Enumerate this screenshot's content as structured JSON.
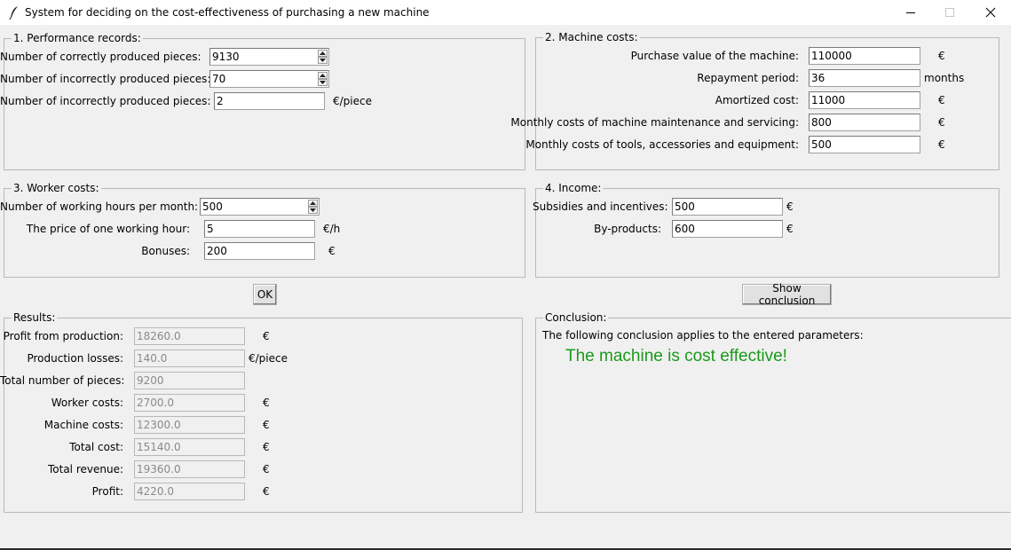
{
  "window": {
    "title": "System for deciding on the cost-effectiveness of purchasing a new machine",
    "icons": {
      "app": "feather-icon",
      "minimize": "minimize-icon",
      "maximize": "maximize-icon",
      "close": "close-icon"
    }
  },
  "performance": {
    "legend": "1. Performance records:",
    "correct_label": "Number of correctly produced pieces:",
    "correct_value": "9130",
    "incorrect_label": "Number of incorrectly produced pieces:",
    "incorrect_value": "70",
    "incorrect_cost_label": "Number of incorrectly produced pieces:",
    "incorrect_cost_value": "2",
    "incorrect_cost_unit": "€/piece"
  },
  "machine": {
    "legend": "2. Machine costs:",
    "purchase_label": "Purchase value of the machine:",
    "purchase_value": "110000",
    "purchase_unit": "€",
    "repayment_label": "Repayment period:",
    "repayment_value": "36",
    "repayment_unit": "months",
    "amortized_label": "Amortized cost:",
    "amortized_value": "11000",
    "amortized_unit": "€",
    "maintenance_label": "Monthly costs of machine maintenance and servicing:",
    "maintenance_value": "800",
    "maintenance_unit": "€",
    "tools_label": "Monthly costs of tools, accessories and equipment:",
    "tools_value": "500",
    "tools_unit": "€"
  },
  "worker": {
    "legend": "3. Worker costs:",
    "hours_label": "Number of working hours per month:",
    "hours_value": "500",
    "price_label": "The price of one working hour:",
    "price_value": "5",
    "price_unit": "€/h",
    "bonuses_label": "Bonuses:",
    "bonuses_value": "200",
    "bonuses_unit": "€"
  },
  "income": {
    "legend": "4. Income:",
    "subsidies_label": "Subsidies and incentives:",
    "subsidies_value": "500",
    "subsidies_unit": "€",
    "byproducts_label": "By-products:",
    "byproducts_value": "600",
    "byproducts_unit": "€"
  },
  "buttons": {
    "ok": "OK",
    "show_conclusion": "Show conclusion"
  },
  "results": {
    "legend": "Results:",
    "rows": [
      {
        "label": "Profit from production:",
        "value": "18260.0",
        "unit": "€"
      },
      {
        "label": "Production losses:",
        "value": "140.0",
        "unit": "€/piece"
      },
      {
        "label": "Total number of pieces:",
        "value": "9200",
        "unit": ""
      },
      {
        "label": "Worker costs:",
        "value": "2700.0",
        "unit": "€"
      },
      {
        "label": "Machine costs:",
        "value": "12300.0",
        "unit": "€"
      },
      {
        "label": "Total cost:",
        "value": "15140.0",
        "unit": "€"
      },
      {
        "label": "Total revenue:",
        "value": "19360.0",
        "unit": "€"
      },
      {
        "label": "Profit:",
        "value": "4220.0",
        "unit": "€"
      }
    ]
  },
  "conclusion": {
    "legend": "Conclusion:",
    "intro": "The following conclusion applies to the entered parameters:",
    "verdict": "The machine is cost effective!",
    "verdict_color": "#1a9a1a"
  }
}
